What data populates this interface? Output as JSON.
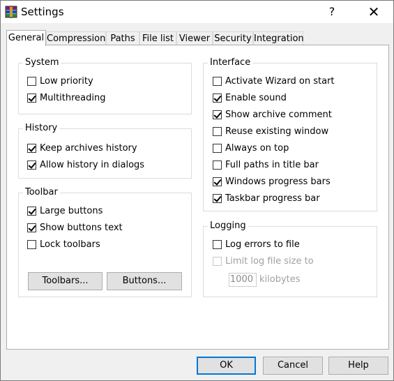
{
  "window": {
    "title": "Settings",
    "help_glyph": "?",
    "close_glyph": "✕"
  },
  "tabs": [
    "General",
    "Compression",
    "Paths",
    "File list",
    "Viewer",
    "Security",
    "Integration"
  ],
  "groups": {
    "system": {
      "title": "System",
      "items": [
        {
          "label": "Low priority",
          "checked": false
        },
        {
          "label": "Multithreading",
          "checked": true
        }
      ]
    },
    "history": {
      "title": "History",
      "items": [
        {
          "label": "Keep archives history",
          "checked": true
        },
        {
          "label": "Allow history in dialogs",
          "checked": true
        }
      ]
    },
    "toolbar": {
      "title": "Toolbar",
      "items": [
        {
          "label": "Large buttons",
          "checked": true
        },
        {
          "label": "Show buttons text",
          "checked": true
        },
        {
          "label": "Lock toolbars",
          "checked": false
        }
      ],
      "toolbars_button": "Toolbars...",
      "buttons_button": "Buttons..."
    },
    "interface": {
      "title": "Interface",
      "items": [
        {
          "label": "Activate Wizard on start",
          "checked": false
        },
        {
          "label": "Enable sound",
          "checked": true
        },
        {
          "label": "Show archive comment",
          "checked": true
        },
        {
          "label": "Reuse existing window",
          "checked": false
        },
        {
          "label": "Always on top",
          "checked": false
        },
        {
          "label": "Full paths in title bar",
          "checked": false
        },
        {
          "label": "Windows progress bars",
          "checked": true
        },
        {
          "label": "Taskbar progress bar",
          "checked": true
        }
      ]
    },
    "logging": {
      "title": "Logging",
      "items": [
        {
          "label": "Log errors to file",
          "checked": false
        },
        {
          "label": "Limit log file size to",
          "checked": false,
          "disabled": true
        }
      ],
      "size_value": "1000",
      "size_unit": "kilobytes"
    }
  },
  "footer": {
    "ok": "OK",
    "cancel": "Cancel",
    "help": "Help"
  },
  "colors": {
    "accent": "#0078d7"
  }
}
